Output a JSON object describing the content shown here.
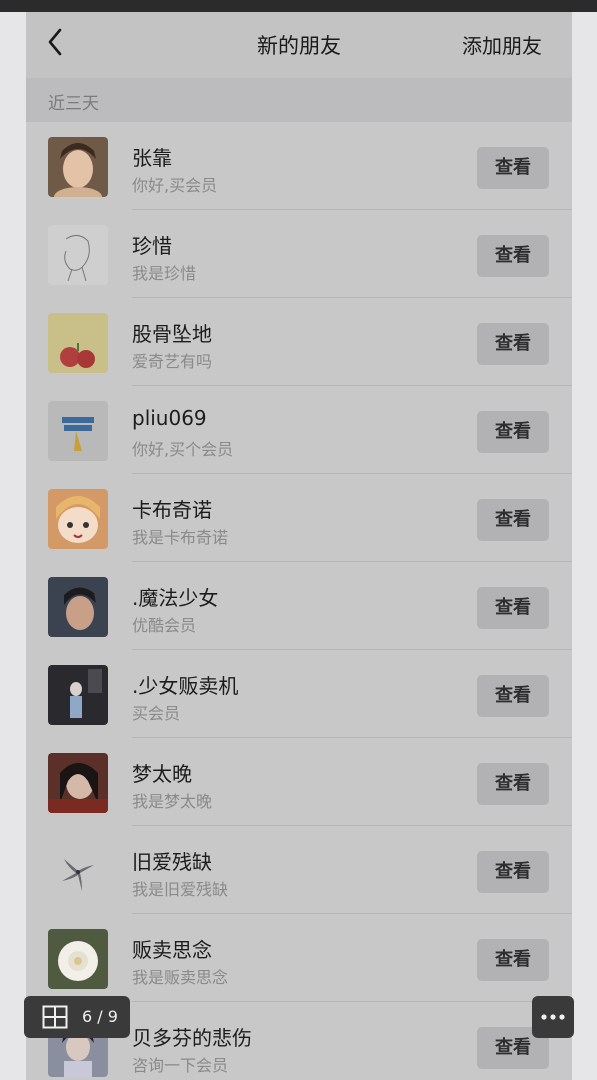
{
  "header": {
    "title": "新的朋友",
    "add_friend_label": "添加朋友",
    "back_icon": "chevron-left-icon"
  },
  "section": {
    "label": "近三天"
  },
  "friends": [
    {
      "name": "张靠",
      "message": "你好,买会员",
      "button": "查看",
      "avatar": "woman-selfie"
    },
    {
      "name": "珍惜",
      "message": "我是珍惜",
      "button": "查看",
      "avatar": "sketch-drawing"
    },
    {
      "name": "股骨坠地",
      "message": "爱奇艺有吗",
      "button": "查看",
      "avatar": "apple-cartoon"
    },
    {
      "name": "pliu069",
      "message": "你好,买个会员",
      "button": "查看",
      "avatar": "back-to-school"
    },
    {
      "name": "卡布奇诺",
      "message": "我是卡布奇诺",
      "button": "查看",
      "avatar": "anime-girl"
    },
    {
      "name": ".魔法少女",
      "message": "优酷会员",
      "button": "查看",
      "avatar": "young-man"
    },
    {
      "name": ".少女贩卖机",
      "message": "买会员",
      "button": "查看",
      "avatar": "dark-street"
    },
    {
      "name": "梦太晚",
      "message": "我是梦太晚",
      "button": "查看",
      "avatar": "girl-portrait"
    },
    {
      "name": "旧爱残缺",
      "message": "我是旧爱残缺",
      "button": "查看",
      "avatar": "flower-sketch"
    },
    {
      "name": "贩卖思念",
      "message": "我是贩卖思念",
      "button": "查看",
      "avatar": "white-flower"
    },
    {
      "name": "贝多芬的悲伤",
      "message": "咨询一下会员",
      "button": "查看",
      "avatar": "girl-phone"
    }
  ],
  "viewer": {
    "page_indicator": "6 / 9",
    "gallery_icon": "grid-icon",
    "more_icon": "more-dots-icon"
  },
  "colors": {
    "panel_bg": "#c8c8c9",
    "header_bg": "#c3c3c4",
    "section_bg": "#bcbbbd",
    "button_bg": "#b2b2b4",
    "overlay_bg": "#3a3a3a"
  }
}
